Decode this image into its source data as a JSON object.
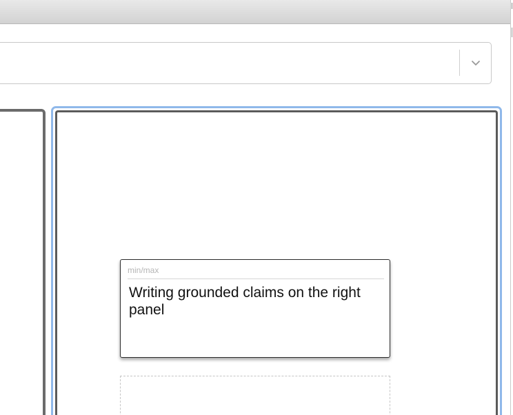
{
  "note_card": {
    "label": "min/max",
    "text": "Writing grounded claims on the right panel"
  },
  "select": {
    "value": "",
    "chevron_icon": "chevron-down-icon"
  },
  "colors": {
    "focus_ring": "#8fb8ea",
    "panel_border": "#5a5a5a",
    "window_bar": "#d9d9d9"
  }
}
